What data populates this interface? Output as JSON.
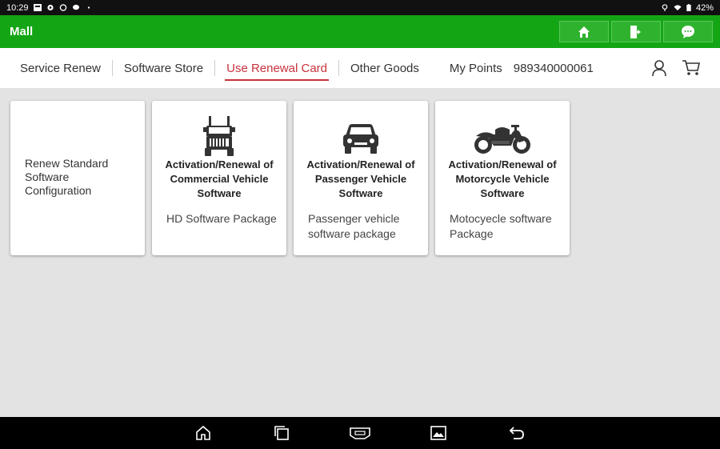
{
  "status": {
    "time": "10:29",
    "battery": "42%"
  },
  "app": {
    "title": "Mall"
  },
  "nav": {
    "tabs": [
      "Service Renew",
      "Software Store",
      "Use Renewal Card",
      "Other Goods"
    ],
    "my_points": "My Points",
    "user_id": "989340000061"
  },
  "cards": [
    {
      "title": "Renew Standard Software Configuration",
      "desc": ""
    },
    {
      "title": "Activation/Renewal of Commercial Vehicle Software",
      "desc": "HD Software Package"
    },
    {
      "title": "Activation/Renewal of Passenger Vehicle Software",
      "desc": "Passenger vehicle software package"
    },
    {
      "title": "Activation/Renewal of Motorcycle Vehicle Software",
      "desc": "Motocyecle software Package"
    }
  ],
  "icons": {
    "home": "home-icon",
    "exit": "exit-icon",
    "chat": "chat-icon",
    "user": "user-icon",
    "cart": "cart-icon",
    "truck": "truck-icon",
    "car": "car-icon",
    "motorcycle": "motorcycle-icon"
  },
  "colors": {
    "header_green": "#14a514",
    "active_tab": "#c8323c"
  }
}
